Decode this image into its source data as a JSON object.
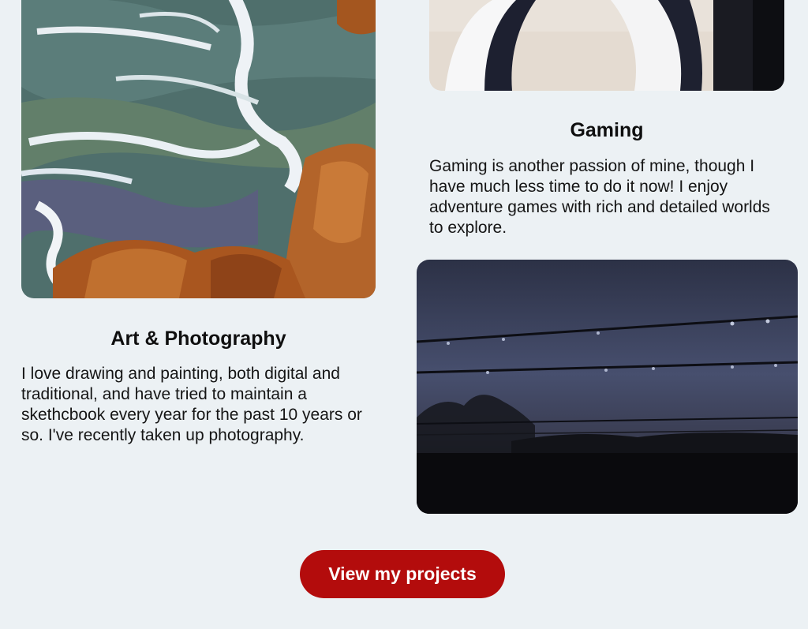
{
  "gaming": {
    "heading": "Gaming",
    "text": "Gaming is another passion of mine, though I have much less time to do it now! I enjoy adventure games with rich and detailed worlds to explore."
  },
  "art": {
    "heading": "Art & Photography",
    "text": "I love drawing and painting, both digital and traditional, and have tried to maintain a skethcbook every year for the past 10 years or so. I've recently taken up photography."
  },
  "cta": {
    "label": "View my projects"
  },
  "colors": {
    "background": "#ecf1f4",
    "button": "#b30c0c",
    "button_text": "#ffffff"
  }
}
